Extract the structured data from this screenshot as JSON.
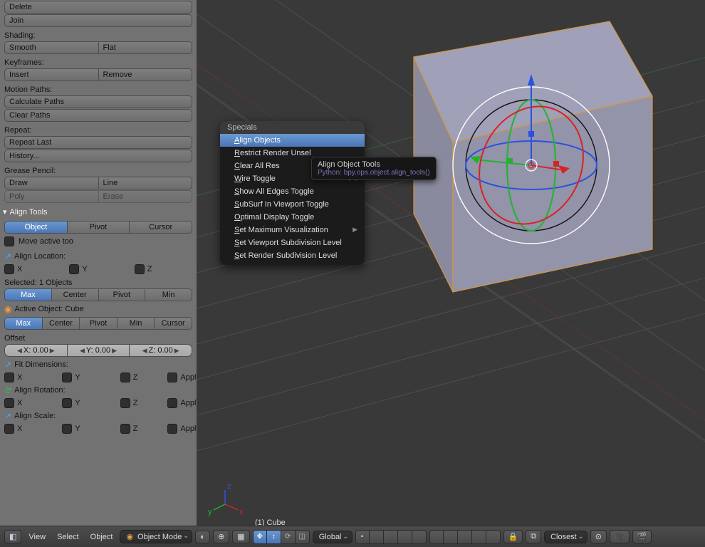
{
  "toolshelf": {
    "delete_label": "Delete",
    "join_label": "Join",
    "shading_label": "Shading:",
    "smooth_label": "Smooth",
    "flat_label": "Flat",
    "keyframes_label": "Keyframes:",
    "insert_label": "Insert",
    "remove_label": "Remove",
    "motionpaths_label": "Motion Paths:",
    "calc_paths_label": "Calculate Paths",
    "clear_paths_label": "Clear Paths",
    "repeat_label": "Repeat:",
    "repeat_last_label": "Repeat Last",
    "history_label": "History...",
    "gpencil_label": "Grease Pencil:",
    "draw_label": "Draw",
    "line_label": "Line",
    "poly_label": "Poly",
    "erase_label": "Erase"
  },
  "align_panel": {
    "header": "Align Tools",
    "tabs": {
      "object": "Object",
      "pivot": "Pivot",
      "cursor": "Cursor"
    },
    "move_active_too": "Move active too",
    "align_location": "Align Location:",
    "axes": {
      "x": "X",
      "y": "Y",
      "z": "Z",
      "apply": "Apply"
    },
    "selected_label": "Selected: 1 Objects",
    "sel_btns": {
      "max": "Max",
      "center": "Center",
      "pivot": "Pivot",
      "min": "Min"
    },
    "active_object_label": "Active Object: Cube",
    "act_btns": {
      "max": "Max",
      "center": "Center",
      "pivot": "Pivot",
      "min": "Min",
      "cursor": "Cursor"
    },
    "offset_label": "Offset",
    "offset_x": "X: 0.00",
    "offset_y": "Y: 0.00",
    "offset_z": "Z: 0.00",
    "fit_dims": "Fit Dimensions:",
    "align_rotation": "Align Rotation:",
    "align_scale": "Align Scale:"
  },
  "viewport": {
    "status": "(1) Cube"
  },
  "context_menu": {
    "title": "Specials",
    "items": [
      {
        "label": "Align Objects",
        "hi": true
      },
      {
        "label": "Restrict Render Unsel"
      },
      {
        "label": "Clear All Res"
      },
      {
        "label": "Wire Toggle",
        "short": "F4"
      },
      {
        "label": "Show All Edges Toggle"
      },
      {
        "label": "SubSurf In Viewport Toggle"
      },
      {
        "label": "Optimal Display Toggle"
      },
      {
        "label": "Set Maximum Visualization",
        "sub": true
      },
      {
        "label": "Set Viewport Subdivision Level"
      },
      {
        "label": "Set Render Subdivision Level"
      }
    ]
  },
  "tooltip": {
    "title": "Align Object Tools",
    "python": "Python: bpy.ops.object.align_tools()"
  },
  "header": {
    "view": "View",
    "select": "Select",
    "object": "Object",
    "mode": "Object Mode",
    "orientation": "Global",
    "snap": "Closest"
  }
}
